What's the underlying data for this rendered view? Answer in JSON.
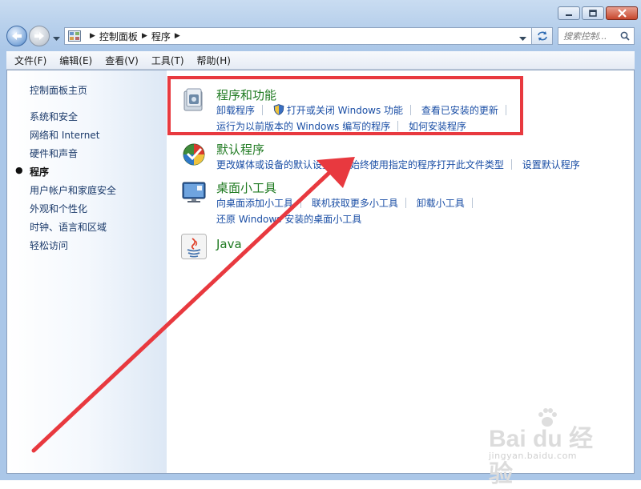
{
  "window": {
    "minimize_icon": "minimize-icon",
    "maximize_icon": "maximize-icon",
    "close_icon": "close-icon"
  },
  "address_bar": {
    "breadcrumbs": [
      "控制面板",
      "程序"
    ],
    "refresh_icon": "refresh-icon"
  },
  "search": {
    "placeholder": "搜索控制..."
  },
  "menubar": {
    "items": [
      "文件(F)",
      "编辑(E)",
      "查看(V)",
      "工具(T)",
      "帮助(H)"
    ]
  },
  "sidebar": {
    "home": "控制面板主页",
    "items": [
      "系统和安全",
      "网络和 Internet",
      "硬件和声音",
      "程序",
      "用户帐户和家庭安全",
      "外观和个性化",
      "时钟、语言和区域",
      "轻松访问"
    ],
    "active_index": 3
  },
  "categories": [
    {
      "title": "程序和功能",
      "icon": "programs-features-icon",
      "link_rows": [
        [
          "卸载程序",
          "打开或关闭 Windows 功能",
          "查看已安装的更新"
        ],
        [
          "运行为以前版本的 Windows 编写的程序",
          "如何安装程序"
        ]
      ]
    },
    {
      "title": "默认程序",
      "icon": "default-programs-icon",
      "link_rows": [
        [
          "更改媒体或设备的默认设置",
          "始终使用指定的程序打开此文件类型",
          "设置默认程序"
        ]
      ]
    },
    {
      "title": "桌面小工具",
      "icon": "desktop-gadgets-icon",
      "link_rows": [
        [
          "向桌面添加小工具",
          "联机获取更多小工具",
          "卸载小工具"
        ],
        [
          "还原 Windows 安装的桌面小工具"
        ]
      ]
    },
    {
      "title": "Java",
      "icon": "java-icon",
      "link_rows": []
    }
  ],
  "annotation": {
    "highlight_color": "#e8393f",
    "arrow_color": "#e8393f"
  },
  "watermark": {
    "logo": "Bai du 经验",
    "url": "jingyan.baidu.com"
  }
}
